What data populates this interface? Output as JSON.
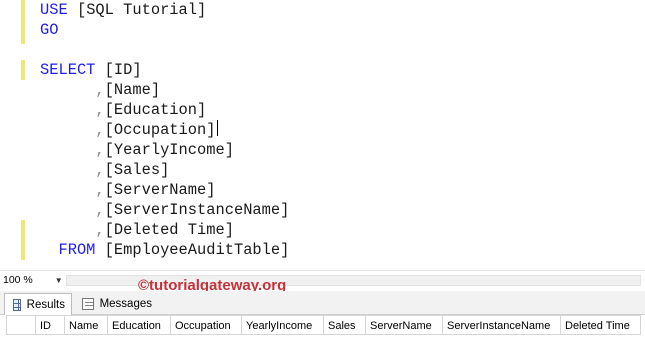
{
  "editor": {
    "lines": [
      [
        {
          "t": "USE ",
          "c": "kw"
        },
        {
          "t": "[SQL Tutorial]",
          "c": "id"
        }
      ],
      [
        {
          "t": "GO",
          "c": "kw"
        }
      ],
      [],
      [
        {
          "t": "SELECT ",
          "c": "kw"
        },
        {
          "t": "[ID]",
          "c": "id"
        }
      ],
      [
        {
          "t": "      ,",
          "c": "comma"
        },
        {
          "t": "[Name]",
          "c": "id"
        }
      ],
      [
        {
          "t": "      ,",
          "c": "comma"
        },
        {
          "t": "[Education]",
          "c": "id"
        }
      ],
      [
        {
          "t": "      ,",
          "c": "comma"
        },
        {
          "t": "[Occupation]",
          "c": "id",
          "caret": true
        }
      ],
      [
        {
          "t": "      ,",
          "c": "comma"
        },
        {
          "t": "[YearlyIncome]",
          "c": "id"
        }
      ],
      [
        {
          "t": "      ,",
          "c": "comma"
        },
        {
          "t": "[Sales]",
          "c": "id"
        }
      ],
      [
        {
          "t": "      ,",
          "c": "comma"
        },
        {
          "t": "[ServerName]",
          "c": "id"
        }
      ],
      [
        {
          "t": "      ,",
          "c": "comma"
        },
        {
          "t": "[ServerInstanceName]",
          "c": "id"
        }
      ],
      [
        {
          "t": "      ,",
          "c": "comma"
        },
        {
          "t": "[Deleted Time]",
          "c": "id"
        }
      ],
      [
        {
          "t": "  FROM ",
          "c": "kw"
        },
        {
          "t": "[EmployeeAuditTable]",
          "c": "id"
        }
      ]
    ]
  },
  "zoom": {
    "value": "100 %"
  },
  "watermark": "©tutorialgateway.org",
  "tabs": [
    {
      "label": "Results",
      "icon": "grid-icon",
      "active": true
    },
    {
      "label": "Messages",
      "icon": "messages-icon",
      "active": false
    }
  ],
  "results": {
    "columns": [
      "ID",
      "Name",
      "Education",
      "Occupation",
      "YearlyIncome",
      "Sales",
      "ServerName",
      "ServerInstanceName",
      "Deleted Time"
    ]
  }
}
